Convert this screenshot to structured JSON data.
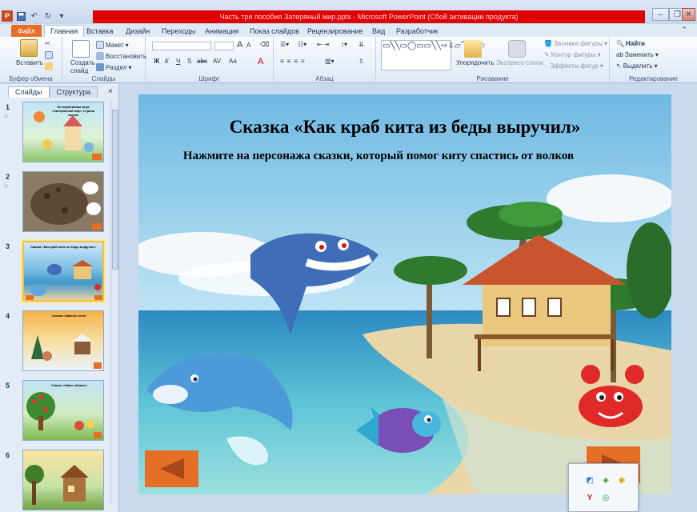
{
  "window": {
    "title": "Часть три пособия Затеряный мир.pptx - Microsoft PowerPoint (Сбой активации продукта)",
    "app_logo": "P"
  },
  "tabs": [
    "Файл",
    "Главная",
    "Вставка",
    "Дизайн",
    "Переходы",
    "Анимация",
    "Показ слайдов",
    "Рецензирование",
    "Вид",
    "Разработчик"
  ],
  "ribbon": {
    "clipboard": {
      "paste": "Вставить",
      "group": "Буфер обмена"
    },
    "slides": {
      "layout": "Макет",
      "reset": "Восстановить",
      "section": "Раздел",
      "new_slide_1": "Создать",
      "new_slide_2": "слайд",
      "group": "Слайды"
    },
    "font": {
      "group": "Шрифт",
      "bold": "Ж",
      "italic": "К",
      "underline": "Ч",
      "strike": "S",
      "abc": "abc",
      "spacing": "AV",
      "case": "Aa",
      "color": "A",
      "grow": "A",
      "shrink": "A"
    },
    "paragraph": {
      "group": "Абзац"
    },
    "drawing": {
      "arrange": "Упорядочить",
      "quick_styles": "Экспресс-стили",
      "fill": "Заливка фигуры",
      "outline": "Контур фигуры",
      "effects": "Эффекты фигур",
      "group": "Рисование"
    },
    "editing": {
      "find": "Найти",
      "replace": "Заменить",
      "select": "Выделить",
      "group": "Редактирование"
    }
  },
  "pane": {
    "tab_slides": "Слайды",
    "tab_outline": "Структура",
    "close": "×",
    "thumbs": [
      {
        "num": "1",
        "text": "Интерактивная игра «Затерянный мир» Страна сказок",
        "star": "☆"
      },
      {
        "num": "2",
        "text": "",
        "star": "☆"
      },
      {
        "num": "3",
        "text": "Сказка «Как краб кита из беды выручил»",
        "star": ""
      },
      {
        "num": "4",
        "text": "Сказка «Зимнее лето»",
        "star": ""
      },
      {
        "num": "5",
        "text": "Сказка «Наше яблоко»",
        "star": ""
      },
      {
        "num": "6",
        "text": "",
        "star": ""
      }
    ]
  },
  "slide": {
    "title": "Сказка «Как краб кита из беды выручил»",
    "subtitle": "Нажмите на персонажа сказки, который помог киту спастись от волков"
  },
  "colors": {
    "accent": "#e66f28",
    "titlebar_red": "#e00000"
  }
}
